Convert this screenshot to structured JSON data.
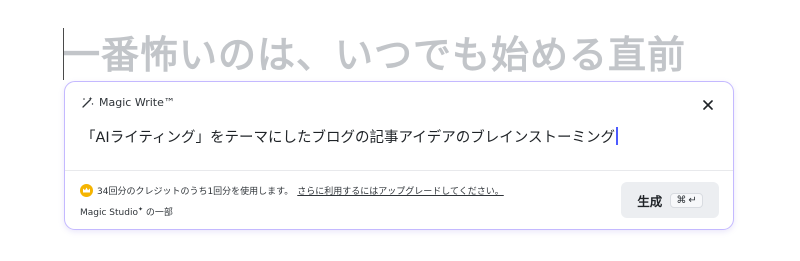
{
  "document": {
    "heading": "一番怖いのは、いつでも始める直前"
  },
  "magic_write": {
    "title": "Magic Write™",
    "prompt_text": "「AIライティング」をテーマにしたブログの記事アイデアのブレインストーミング",
    "credits_text": "34回分のクレジットのうち1回分を使用します。",
    "upgrade_link": "さらに利用するにはアップグレードしてください。",
    "studio_name": "Magic Studio",
    "studio_suffix": "の一部",
    "generate_label": "生成",
    "shortcut_cmd": "⌘",
    "shortcut_enter": "↵"
  },
  "colors": {
    "panel_border": "#c4b9ff",
    "accent_caret": "#4d5bff",
    "crown": "#f5b400",
    "heading_placeholder": "#c2c5c9"
  },
  "icons": {
    "header": "magic-wand-icon",
    "close": "close-icon",
    "credits": "crown-icon"
  }
}
